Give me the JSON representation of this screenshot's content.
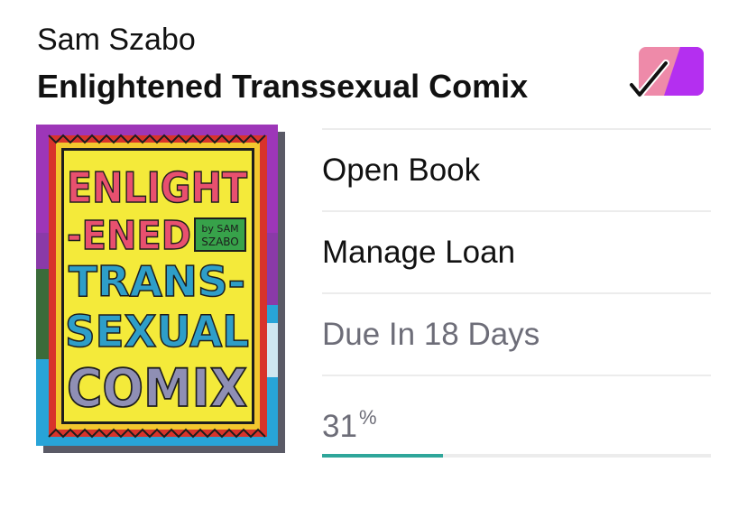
{
  "book": {
    "author": "Sam Szabo",
    "title": "Enlightened Transsexual Comix",
    "cover": {
      "title_lines": [
        "ENLIGHT",
        "-ENED",
        "TRANS-",
        "SEXUAL",
        "COMIX"
      ],
      "byline_lines": [
        "by SAM",
        "SZABO"
      ]
    }
  },
  "tag_icon": {
    "name": "tag-check-icon",
    "colors": [
      "#ee8aa9",
      "#b42ff0"
    ]
  },
  "actions": {
    "open_book": "Open Book",
    "manage_loan": "Manage Loan"
  },
  "loan": {
    "due_text": "Due In 18 Days"
  },
  "progress": {
    "value": "31",
    "unit": "%",
    "fraction": 0.31,
    "color": "#2fa69a"
  }
}
